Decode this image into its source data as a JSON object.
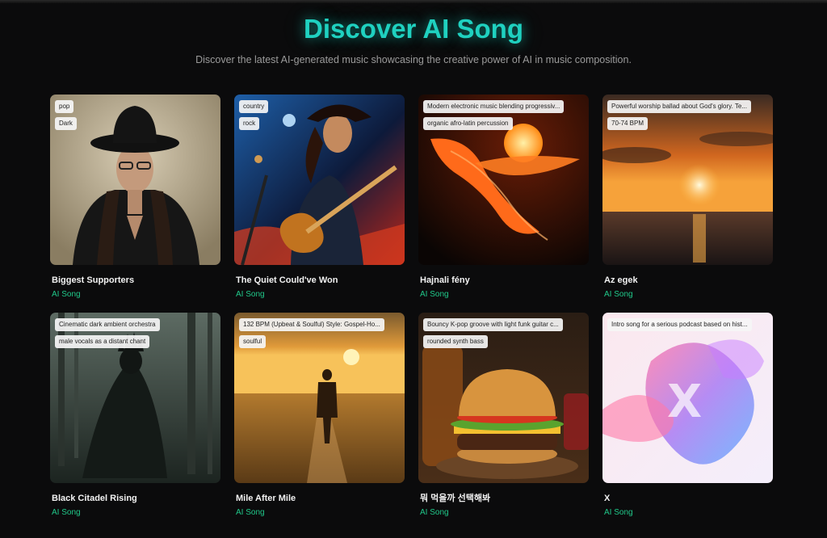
{
  "page": {
    "title": "Discover AI Song",
    "subtitle": "Discover the latest AI-generated music showcasing the creative power of AI in music composition."
  },
  "songs": [
    {
      "title": "Biggest Supporters",
      "type": "AI Song",
      "tags": [
        "pop",
        "Dark"
      ],
      "image": "woman-in-black-hat-image"
    },
    {
      "title": "The Quiet Could've Won",
      "type": "AI Song",
      "tags": [
        "country",
        "rock"
      ],
      "image": "guitarist-performing-image"
    },
    {
      "title": "Hajnali fény",
      "type": "AI Song",
      "tags": [
        "Modern electronic music blending progressiv...",
        "organic afro-latin percussion"
      ],
      "image": "orange-flame-ribbon-image"
    },
    {
      "title": "Az egek",
      "type": "AI Song",
      "tags": [
        "Powerful worship ballad about God's glory. Te...",
        "70-74 BPM"
      ],
      "image": "sunset-over-sea-image"
    },
    {
      "title": "Black Citadel Rising",
      "type": "AI Song",
      "tags": [
        "Cinematic dark ambient orchestra",
        "male vocals as a distant chant"
      ],
      "image": "dark-cloaked-figure-image"
    },
    {
      "title": "Mile After Mile",
      "type": "AI Song",
      "tags": [
        "132 BPM (Upbeat & Soulful) Style: Gospel-Ho...",
        "soulful"
      ],
      "image": "man-walking-sunset-field-image"
    },
    {
      "title": "뭐 먹을까 선택해봐",
      "type": "AI Song",
      "tags": [
        "Bouncy K-pop groove with light funk guitar c...",
        "rounded synth bass"
      ],
      "image": "burger-on-board-image"
    },
    {
      "title": "X",
      "type": "AI Song",
      "tags": [
        "Intro song for a serious podcast based on hist..."
      ],
      "image": "abstract-pastel-x-image"
    }
  ],
  "colors": {
    "background": "#0b0b0c",
    "title_accent": "#1fd1c0",
    "song_type_accent": "#20c98a"
  }
}
